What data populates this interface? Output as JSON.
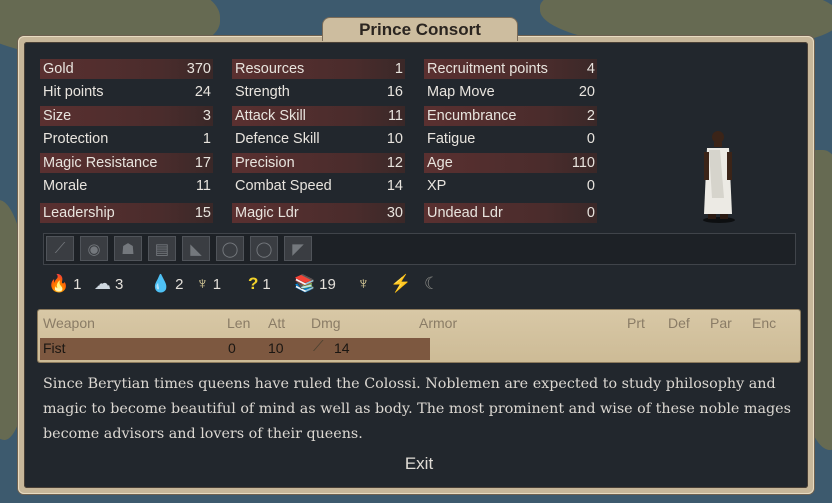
{
  "window": {
    "title": "Prince Consort",
    "exit_label": "Exit"
  },
  "stats": {
    "col1": [
      {
        "label": "Gold",
        "value": "370"
      },
      {
        "label": "Hit points",
        "value": "24"
      },
      {
        "label": "Size",
        "value": "3"
      },
      {
        "label": "Protection",
        "value": "1"
      },
      {
        "label": "Magic Resistance",
        "value": "17"
      },
      {
        "label": "Morale",
        "value": "11"
      },
      {
        "label": "Leadership",
        "value": "15"
      }
    ],
    "col2": [
      {
        "label": "Resources",
        "value": "1"
      },
      {
        "label": "Strength",
        "value": "16"
      },
      {
        "label": "Attack Skill",
        "value": "11"
      },
      {
        "label": "Defence Skill",
        "value": "10"
      },
      {
        "label": "Precision",
        "value": "12"
      },
      {
        "label": "Combat Speed",
        "value": "14"
      },
      {
        "label": "Magic Ldr",
        "value": "30"
      }
    ],
    "col3": [
      {
        "label": "Recruitment points",
        "value": "4"
      },
      {
        "label": "Map Move",
        "value": "20"
      },
      {
        "label": "Encumbrance",
        "value": "2"
      },
      {
        "label": "Fatigue",
        "value": "0"
      },
      {
        "label": "Age",
        "value": "110"
      },
      {
        "label": "XP",
        "value": "0"
      },
      {
        "label": "Undead Ldr",
        "value": "0"
      }
    ]
  },
  "item_slots": [
    "weapon-slot",
    "shield-slot",
    "helmet-slot",
    "armor-slot",
    "boots-slot",
    "ring-slot",
    "ring-slot-2",
    "misc-slot"
  ],
  "magic_paths": [
    {
      "name": "fire",
      "icon": "fire-icon",
      "value": "1"
    },
    {
      "name": "air",
      "icon": "air-icon",
      "value": "3"
    },
    {
      "name": "water",
      "icon": "water-icon",
      "value": "2"
    },
    {
      "name": "astral",
      "icon": "astral-icon",
      "value": "1"
    },
    {
      "name": "random",
      "icon": "random-icon",
      "value": "1"
    },
    {
      "name": "research",
      "icon": "research-icon",
      "value": "19"
    }
  ],
  "abilities": [
    "sacred-icon",
    "spirit-sight-icon",
    "recuperation-icon"
  ],
  "weapon_table": {
    "headers": {
      "weapon": "Weapon",
      "len": "Len",
      "att": "Att",
      "dmg": "Dmg",
      "armor": "Armor",
      "prt": "Prt",
      "def": "Def",
      "par": "Par",
      "enc": "Enc"
    },
    "rows": [
      {
        "weapon": "Fist",
        "len": "0",
        "att": "10",
        "dmg": "14"
      }
    ]
  },
  "description": "Since Berytian times queens have ruled the Colossi. Noblemen are expected to study philosophy and magic to become beautiful of mind as well as body. The most prominent and wise of these noble mages become advisors and lovers of their queens.",
  "colors": {
    "panel": "#22272d",
    "frame": "#c7b79a",
    "stat_shade": "#5a3030",
    "parchment": "#d8c8a6"
  }
}
